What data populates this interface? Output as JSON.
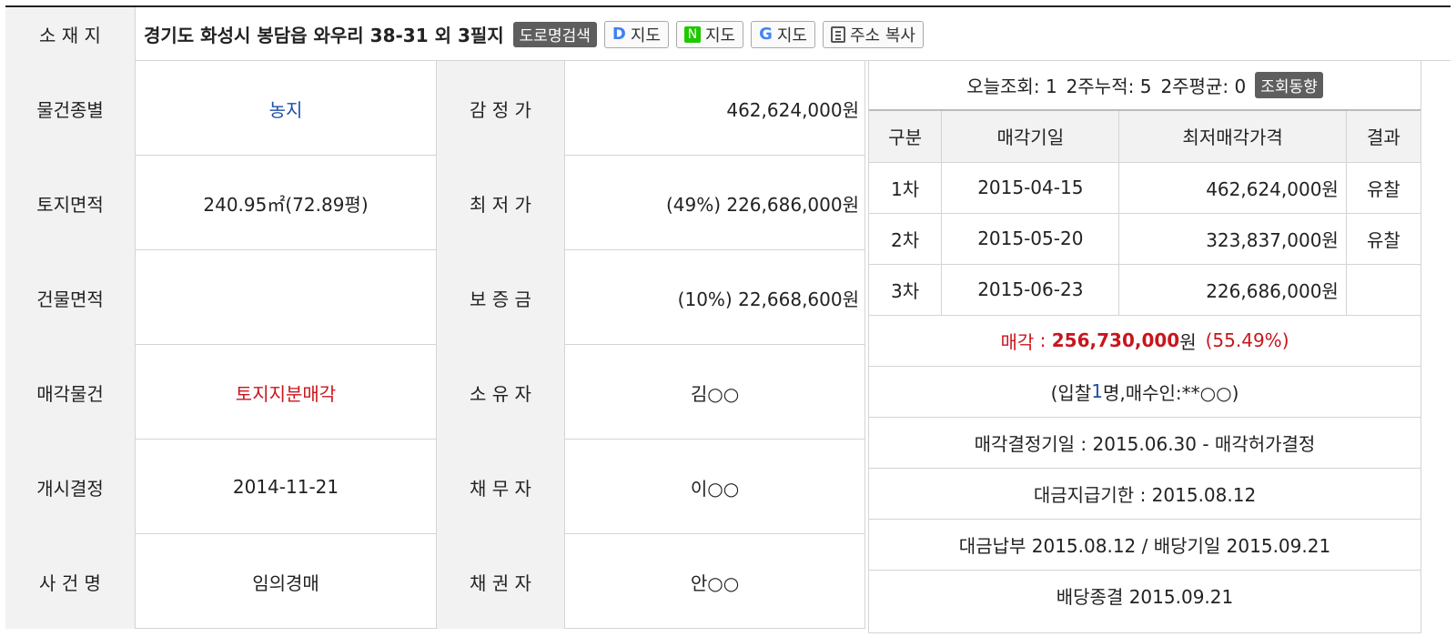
{
  "address": {
    "label": "소 재 지",
    "value": "경기도 화성시 봉담읍 와우리 38-31 외 3필지",
    "road_search_btn": "도로명검색",
    "map_daum": {
      "logo": "D",
      "label": "지도"
    },
    "map_naver": {
      "logo": "N",
      "label": "지도"
    },
    "map_google": {
      "logo": "G",
      "label": "지도"
    },
    "copy_btn": "주소 복사"
  },
  "rows": [
    {
      "label1": "물건종별",
      "value1": "농지",
      "label2": "감 정 가",
      "value2": "462,624,000원"
    },
    {
      "label1": "토지면적",
      "value1": "240.95㎡(72.89평)",
      "label2": "최 저 가",
      "value2": "(49%) 226,686,000원"
    },
    {
      "label1": "건물면적",
      "value1": "",
      "label2": "보 증 금",
      "value2": "(10%) 22,668,600원"
    },
    {
      "label1": "매각물건",
      "value1": "토지지분매각",
      "label2": "소 유 자",
      "value2": "김○○"
    },
    {
      "label1": "개시결정",
      "value1": "2014-11-21",
      "label2": "채 무 자",
      "value2": "이○○"
    },
    {
      "label1": "사 건 명",
      "value1": "임의경매",
      "label2": "채 권 자",
      "value2": "안○○"
    }
  ],
  "views": {
    "today_label": "오늘조회:",
    "today": "1",
    "two_week_label": "2주누적:",
    "two_week": "5",
    "avg_label": "2주평균:",
    "avg": "0",
    "trend_btn": "조회동향"
  },
  "rounds": {
    "headers": [
      "구분",
      "매각기일",
      "최저매각가격",
      "결과"
    ],
    "rows": [
      {
        "round": "1차",
        "date": "2015-04-15",
        "price": "462,624,000원",
        "result": "유찰"
      },
      {
        "round": "2차",
        "date": "2015-05-20",
        "price": "323,837,000원",
        "result": "유찰"
      },
      {
        "round": "3차",
        "date": "2015-06-23",
        "price": "226,686,000원",
        "result": ""
      }
    ]
  },
  "sale": {
    "label": "매각",
    "sep": " : ",
    "amount": "256,730,000",
    "unit": "원",
    "ratio": "(55.49%)"
  },
  "bid": {
    "prefix": "(입찰",
    "count": "1",
    "suffix": "명,매수인:**○○)"
  },
  "decision": "매각결정기일 : 2015.06.30 - 매각허가결정",
  "payment_deadline": "대금지급기한 : 2015.08.12",
  "payment": "대금납부 2015.08.12 / 배당기일 2015.09.21",
  "dividend": "배당종결 2015.09.21",
  "colors": {
    "link_blue": "#1f4fa5",
    "accent_red": "#c8161d",
    "label_bg": "#f2f2f2",
    "button_dark": "#5e5e5e"
  }
}
